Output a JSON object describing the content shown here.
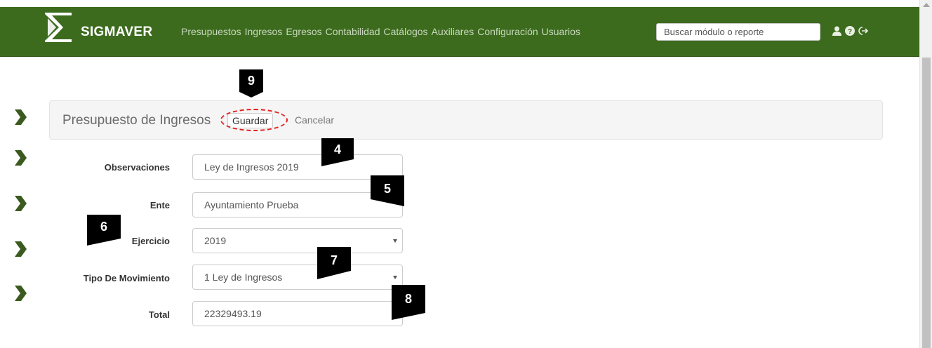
{
  "app": {
    "brand": "SIGMAVER"
  },
  "nav": {
    "items": [
      "Presupuestos",
      "Ingresos",
      "Egresos",
      "Contabilidad",
      "Catálogos",
      "Auxiliares",
      "Configuración",
      "Usuarios"
    ],
    "search_placeholder": "Buscar módulo o reporte",
    "icons": [
      "user-icon",
      "help-icon",
      "logout-icon"
    ]
  },
  "colors": {
    "navbar": "#3c6b1e",
    "sidebar_chevron": "#3b5a1f",
    "highlight": "#e32222"
  },
  "panel": {
    "title": "Presupuesto de Ingresos",
    "save_label": "Guardar",
    "cancel_label": "Cancelar"
  },
  "form": {
    "observaciones": {
      "label": "Observaciones",
      "value": "Ley de Ingresos 2019"
    },
    "ente": {
      "label": "Ente",
      "value": "Ayuntamiento Prueba"
    },
    "ejercicio": {
      "label": "Ejercicio",
      "value": "2019"
    },
    "tipo": {
      "label": "Tipo De Movimiento",
      "value": "1 Ley de Ingresos"
    },
    "total": {
      "label": "Total",
      "value": "22329493.19"
    }
  },
  "markers": {
    "m4": "4",
    "m5": "5",
    "m6": "6",
    "m7": "7",
    "m8": "8",
    "m9": "9"
  }
}
